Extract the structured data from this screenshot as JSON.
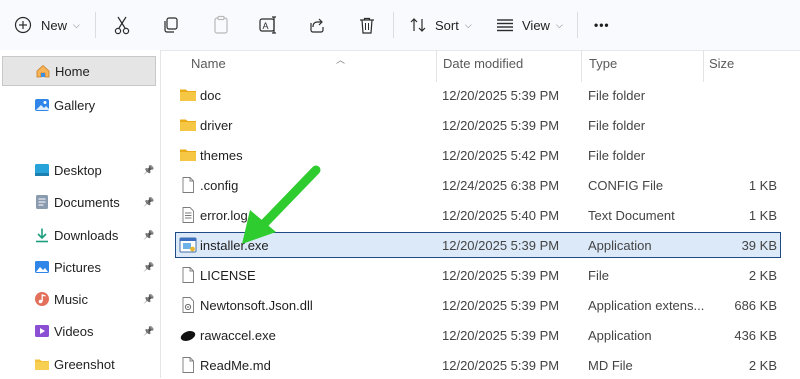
{
  "toolbar": {
    "new_label": "New",
    "sort_label": "Sort",
    "view_label": "View",
    "more_label": "•••"
  },
  "sidebar": {
    "items": [
      {
        "label": "Home",
        "icon": "home-icon",
        "selected": true
      },
      {
        "label": "Gallery",
        "icon": "gallery-icon"
      },
      {
        "label": "Desktop",
        "icon": "desktop-icon",
        "pinned": true
      },
      {
        "label": "Documents",
        "icon": "documents-icon",
        "pinned": true
      },
      {
        "label": "Downloads",
        "icon": "downloads-icon",
        "pinned": true
      },
      {
        "label": "Pictures",
        "icon": "pictures-icon",
        "pinned": true
      },
      {
        "label": "Music",
        "icon": "music-icon",
        "pinned": true
      },
      {
        "label": "Videos",
        "icon": "videos-icon",
        "pinned": true
      },
      {
        "label": "Greenshot",
        "icon": "folder-icon"
      }
    ],
    "pin_glyph": "📌"
  },
  "columns": {
    "name": "Name",
    "date": "Date modified",
    "type": "Type",
    "size": "Size"
  },
  "files": [
    {
      "name": "doc",
      "date": "12/20/2025 5:39 PM",
      "type": "File folder",
      "size": "",
      "icon": "folder-icon"
    },
    {
      "name": "driver",
      "date": "12/20/2025 5:39 PM",
      "type": "File folder",
      "size": "",
      "icon": "folder-icon"
    },
    {
      "name": "themes",
      "date": "12/20/2025 5:42 PM",
      "type": "File folder",
      "size": "",
      "icon": "folder-icon"
    },
    {
      "name": ".config",
      "date": "12/24/2025 6:38 PM",
      "type": "CONFIG File",
      "size": "1 KB",
      "icon": "file-icon"
    },
    {
      "name": "error.log",
      "date": "12/20/2025 5:40 PM",
      "type": "Text Document",
      "size": "1 KB",
      "icon": "text-file-icon"
    },
    {
      "name": "installer.exe",
      "date": "12/20/2025 5:39 PM",
      "type": "Application",
      "size": "39 KB",
      "icon": "exe-icon",
      "selected": true
    },
    {
      "name": "LICENSE",
      "date": "12/20/2025 5:39 PM",
      "type": "File",
      "size": "2 KB",
      "icon": "file-icon"
    },
    {
      "name": "Newtonsoft.Json.dll",
      "date": "12/20/2025 5:39 PM",
      "type": "Application extens...",
      "size": "686 KB",
      "icon": "dll-icon"
    },
    {
      "name": "rawaccel.exe",
      "date": "12/20/2025 5:39 PM",
      "type": "Application",
      "size": "436 KB",
      "icon": "mouse-app-icon"
    },
    {
      "name": "ReadMe.md",
      "date": "12/20/2025 5:39 PM",
      "type": "MD File",
      "size": "2 KB",
      "icon": "file-icon"
    }
  ],
  "colors": {
    "selection_bg": "#dbe9f9",
    "selection_border": "#1f4a86",
    "folder": "#f3c13a",
    "annotation_arrow": "#2ecc2e"
  }
}
